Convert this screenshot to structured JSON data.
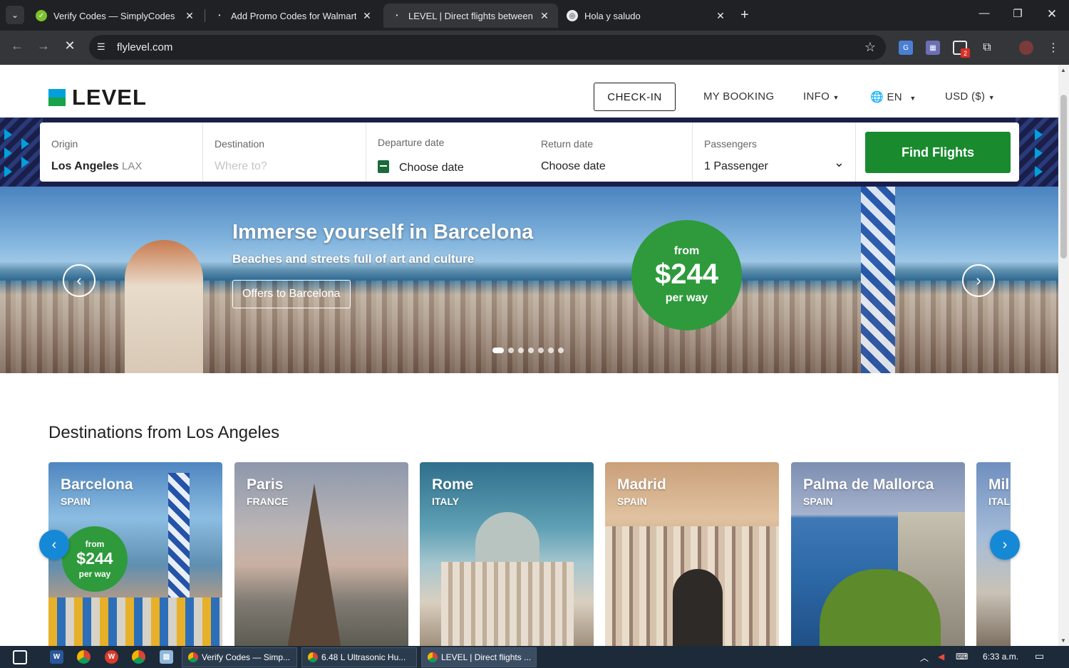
{
  "browser": {
    "tabs": [
      {
        "title": "Verify Codes — SimplyCodes",
        "active": false
      },
      {
        "title": "Add Promo Codes for Walmart",
        "active": false
      },
      {
        "title": "LEVEL | Direct flights between B",
        "active": true
      },
      {
        "title": "Hola y saludo",
        "active": false
      }
    ],
    "url": "flylevel.com",
    "ext_badge": "2"
  },
  "header": {
    "logo_text": "LEVEL",
    "checkin_label": "CHECK-IN",
    "my_booking_label": "MY BOOKING",
    "info_label": "INFO",
    "language_label": "EN",
    "currency_label": "USD ($)"
  },
  "search": {
    "origin_label": "Origin",
    "origin_city": "Los Angeles",
    "origin_code": "LAX",
    "destination_label": "Destination",
    "destination_placeholder": "Where to?",
    "departure_label": "Departure date",
    "departure_value": "Choose date",
    "return_label": "Return date",
    "return_value": "Choose date",
    "passengers_label": "Passengers",
    "passengers_value": "1 Passenger",
    "find_label": "Find Flights"
  },
  "hero": {
    "title": "Immerse yourself in Barcelona",
    "subtitle": "Beaches and streets full of art and culture",
    "offer_label": "Offers to Barcelona",
    "price_from": "from",
    "price_amount": "$244",
    "price_per": "per way",
    "slide_count": 7,
    "active_slide": 1
  },
  "destinations": {
    "title": "Destinations from Los Angeles",
    "cards": [
      {
        "city": "Barcelona",
        "country": "SPAIN",
        "from": "from",
        "price": "$244",
        "per": "per way"
      },
      {
        "city": "Paris",
        "country": "FRANCE"
      },
      {
        "city": "Rome",
        "country": "ITALY"
      },
      {
        "city": "Madrid",
        "country": "SPAIN"
      },
      {
        "city": "Palma de Mallorca",
        "country": "SPAIN"
      },
      {
        "city": "Mil",
        "country": "ITAL"
      }
    ]
  },
  "taskbar": {
    "apps": [
      {
        "title": "Verify Codes — Simp..."
      },
      {
        "title": "6.48 L Ultrasonic Hu..."
      },
      {
        "title": "LEVEL | Direct flights ..."
      }
    ],
    "time": "6:33 a.m."
  },
  "colors": {
    "brand_green": "#1a8a2e",
    "badge_green": "#2e9a3c",
    "navy": "#1a1f4a",
    "accent_blue": "#00a0dc"
  }
}
